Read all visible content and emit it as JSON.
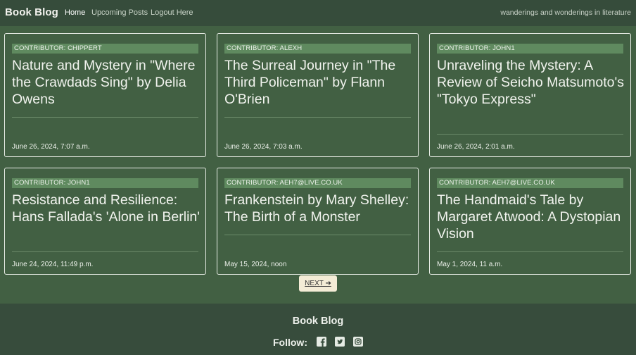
{
  "navbar": {
    "brand": "Book Blog",
    "links": [
      "Home",
      "Upcoming Posts",
      "Logout Here"
    ],
    "tagline": "wanderings and wonderings in literature"
  },
  "posts": [
    {
      "contributor": "CONTRIBUTOR: CHIPPERT",
      "title": "Nature and Mystery in \"Where the Crawdads Sing\" by Delia Owens",
      "date": "June 26, 2024, 7:07 a.m."
    },
    {
      "contributor": "CONTRIBUTOR: ALEXH",
      "title": "The Surreal Journey in \"The Third Policeman\" by Flann O'Brien",
      "date": "June 26, 2024, 7:03 a.m."
    },
    {
      "contributor": "CONTRIBUTOR: JOHN1",
      "title": "Unraveling the Mystery: A Review of Seicho Matsumoto's \"Tokyo Express\"",
      "date": "June 26, 2024, 2:01 a.m."
    },
    {
      "contributor": "CONTRIBUTOR: JOHN1",
      "title": "Resistance and Resilience: Hans Fallada's 'Alone in Berlin'",
      "date": "June 24, 2024, 11:49 p.m."
    },
    {
      "contributor": "CONTRIBUTOR: AEH7@LIVE.CO.UK",
      "title": "Frankenstein by Mary Shelley: The Birth of a Monster",
      "date": "May 15, 2024, noon"
    },
    {
      "contributor": "CONTRIBUTOR: AEH7@LIVE.CO.UK",
      "title": "The Handmaid's Tale by Margaret Atwood: A Dystopian Vision",
      "date": "May 1, 2024, 11 a.m."
    }
  ],
  "pagination": {
    "next_label": "NEXT ➔"
  },
  "footer": {
    "brand": "Book Blog",
    "follow_label": "Follow:",
    "social_icons": [
      "facebook-icon",
      "twitter-icon",
      "instagram-icon"
    ]
  },
  "colors": {
    "background": "#426043",
    "navbar": "#364c3b",
    "badge": "#5f8a5f",
    "next_button": "#f4ecd6"
  }
}
